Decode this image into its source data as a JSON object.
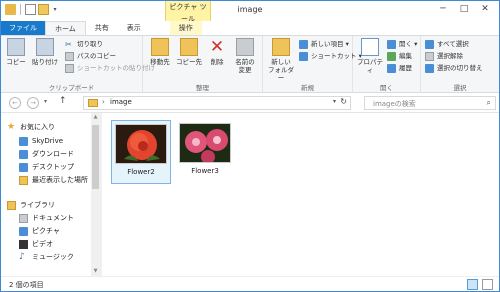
{
  "window": {
    "title": "image",
    "contextual_tab_group": "ピクチャ ツール",
    "minimize": "─",
    "maximize": "□",
    "close": "✕"
  },
  "ribbon_tabs": [
    "ファイル",
    "ホーム",
    "共有",
    "表示",
    "操作"
  ],
  "ribbon": {
    "clipboard": {
      "label": "クリップボード",
      "copy": "コピー",
      "paste": "貼り付け",
      "cut": "切り取り",
      "copy_path": "パスのコピー",
      "paste_shortcut": "ショートカットの貼り付け"
    },
    "organize": {
      "label": "整理",
      "move_to": "移動先",
      "copy_to": "コピー先",
      "delete": "削除",
      "rename_line1": "名前の",
      "rename_line2": "変更"
    },
    "new": {
      "label": "新規",
      "new_folder_line1": "新しい",
      "new_folder_line2": "フォルダー",
      "new_item": "新しい項目 ▾",
      "shortcut": "ショートカット ▾"
    },
    "open": {
      "label": "開く",
      "properties": "プロパティ",
      "open": "開く ▾",
      "edit": "編集",
      "history": "履歴"
    },
    "select": {
      "label": "選択",
      "select_all": "すべて選択",
      "select_none": "選択解除",
      "invert": "選択の切り替え"
    }
  },
  "navigation": {
    "back": "←",
    "forward": "→",
    "recent": "▾",
    "up": "↑",
    "address_path": "image",
    "address_chevron": "›",
    "refresh": "↻",
    "search_placeholder": "imageの検索",
    "search_icon": "⌕"
  },
  "nav_pane": {
    "favorites": "お気に入り",
    "items_fav": [
      "SkyDrive",
      "ダウンロード",
      "デスクトップ",
      "最近表示した場所"
    ],
    "libraries": "ライブラリ",
    "items_lib": [
      "ドキュメント",
      "ピクチャ",
      "ビデオ",
      "ミュージック"
    ]
  },
  "files": [
    {
      "name": "Flower2",
      "selected": true
    },
    {
      "name": "Flower3",
      "selected": false
    }
  ],
  "status": {
    "item_count": "2 個の項目"
  },
  "colors": {
    "accent": "#1979ca",
    "context_tab": "#fff3a6",
    "selection": "#e5f3fb"
  }
}
